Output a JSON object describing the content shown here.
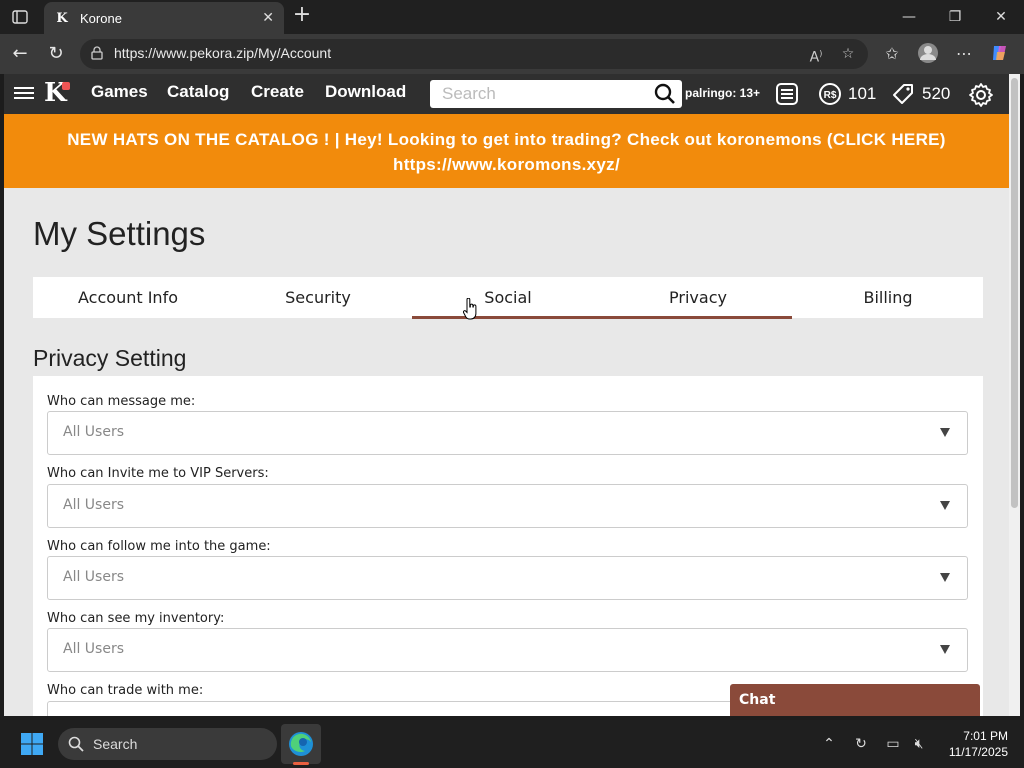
{
  "browser": {
    "tab_title": "Korone",
    "url": "https://www.pekora.zip/My/Account",
    "read_aloud_icon": "read-aloud-icon",
    "favorite_icon": "star-icon"
  },
  "site": {
    "nav_links": [
      "Games",
      "Catalog",
      "Create",
      "Download"
    ],
    "search_placeholder": "Search",
    "username": "palringo: 13+",
    "robux": "101",
    "tix": "520",
    "banner": "NEW HATS ON THE CATALOG ! | Hey! Looking to get into trading? Check out koronemons (CLICK HERE) https://www.koromons.xyz/"
  },
  "page": {
    "title": "My Settings",
    "tabs": [
      "Account Info",
      "Security",
      "Social",
      "Privacy",
      "Billing"
    ],
    "section_title": "Privacy Setting",
    "fields": [
      {
        "label": "Who can message me:",
        "value": "All Users"
      },
      {
        "label": "Who can Invite me to VIP Servers:",
        "value": "All Users"
      },
      {
        "label": "Who can follow me into the game:",
        "value": "All Users"
      },
      {
        "label": "Who can see my inventory:",
        "value": "All Users"
      },
      {
        "label": "Who can trade with me:",
        "value": ""
      }
    ],
    "chat_label": "Chat"
  },
  "taskbar": {
    "search_label": "Search",
    "time": "7:01 PM",
    "date": "11/17/2025"
  },
  "colors": {
    "banner": "#f28b0c",
    "nav_bg": "#2f2f2f",
    "accent": "#8a4a3a"
  }
}
